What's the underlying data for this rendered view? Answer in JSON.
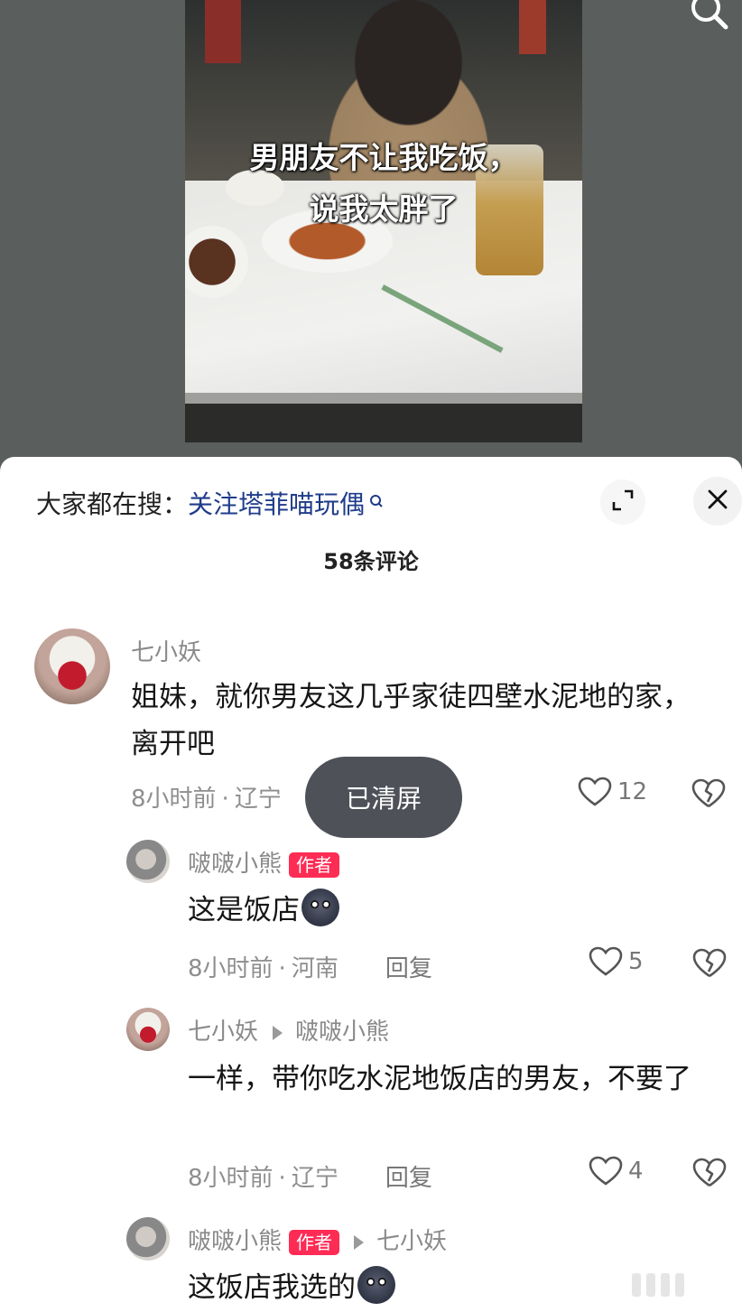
{
  "video": {
    "caption_line1": "男朋友不让我吃饭，",
    "caption_line2": "说我太胖了"
  },
  "icons": {
    "search": "search-icon",
    "expand": "expand-icon",
    "close": "close-icon",
    "like": "heart-icon",
    "dislike": "broken-heart-icon"
  },
  "search_hint": {
    "label": "大家都在搜：",
    "query": "关注塔菲喵玩偶"
  },
  "comment_count": "58条评论",
  "toast": "已清屏",
  "comments": [
    {
      "user": "七小妖",
      "text": "姐妹，就你男友这几乎家徒四壁水泥地的家，离开吧",
      "time": "8小时前",
      "location": "辽宁",
      "likes": "12"
    },
    {
      "user": "啵啵小熊",
      "tag": "作者",
      "text": "这是饭店",
      "time": "8小时前",
      "location": "河南",
      "reply": "回复",
      "likes": "5"
    },
    {
      "user": "七小妖",
      "reply_to": "啵啵小熊",
      "text": "一样，带你吃水泥地饭店的男友，不要了",
      "time": "8小时前",
      "location": "辽宁",
      "reply": "回复",
      "likes": "4"
    },
    {
      "user": "啵啵小熊",
      "tag": "作者",
      "reply_to": "七小妖",
      "text": "这饭店我选的"
    }
  ],
  "colors": {
    "author_tag": "#fe2c55",
    "search_link": "#1f3c8a",
    "toast_bg": "#464850"
  }
}
